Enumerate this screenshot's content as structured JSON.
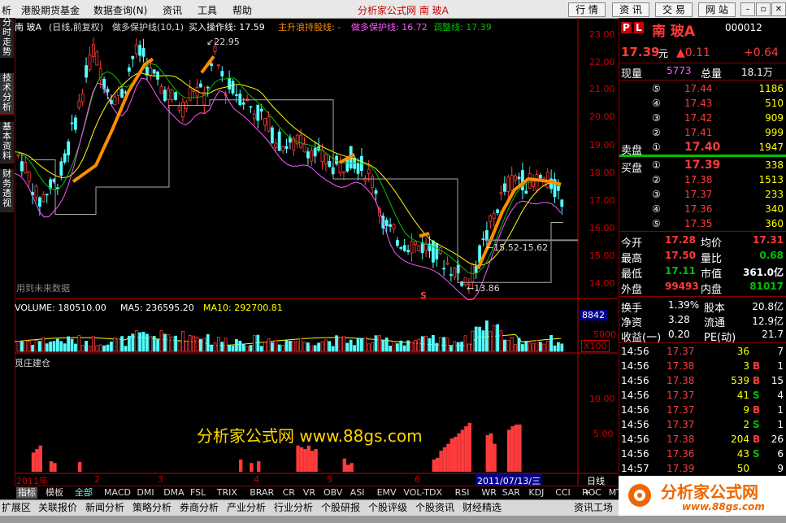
{
  "menu": {
    "items": [
      "析",
      "港股期货基金",
      "数据查询(N)",
      "资讯",
      "工具",
      "帮助"
    ],
    "site_title": "分析家公式网  南  玻A",
    "buttons": [
      "行 情",
      "资 讯",
      "交 易",
      "网 站"
    ]
  },
  "left_tabs": [
    "分时走势",
    "技术分析",
    "基本资料",
    "财务透视"
  ],
  "chart_header": {
    "stock": "南  玻A",
    "mode": "(日线,前复权)",
    "line1": "做多保护线(10,1)",
    "line2": "买入操作线: 17.59",
    "line3": "主升浪持股线: -",
    "line4": "做多保护线: 16.72",
    "line5": "调整线: 17.39"
  },
  "price_axis": [
    "23.00",
    "22.00",
    "21.00",
    "20.00",
    "19.00",
    "18.00",
    "17.00",
    "16.00",
    "15.00",
    "14.00"
  ],
  "annotations": {
    "high": "22.95",
    "low": "13.86",
    "range": "15.52-15.62",
    "future_note": "用到未来数据",
    "marker": "S"
  },
  "volume": {
    "header_vol": "VOLUME: 180510.00",
    "header_ma5": "MA5: 236595.20",
    "header_ma10": "MA10: 292700.81",
    "axis_top": "8842",
    "axis_mid": "5000",
    "axis_unit": "X100"
  },
  "indicator": {
    "name": "觅庄建仓",
    "axis": [
      "10.00",
      "5.00"
    ],
    "watermark": "分析家公式网  www.88gs.com"
  },
  "time_axis": {
    "labels": [
      "2011年",
      "2",
      "3",
      "4",
      "5",
      "6"
    ],
    "cursor_date": "2011/07/13/三",
    "period": "日线"
  },
  "indicator_tabs": [
    "指标",
    "模板",
    "全部",
    "MACD",
    "DMI",
    "DMA",
    "FSL",
    "TRIX",
    "BRAR",
    "CR",
    "VR",
    "OBV",
    "ASI",
    "EMV",
    "VOL-TDX",
    "RSI",
    "WR",
    "SAR",
    "KDJ",
    "CCI",
    "ROC",
    "MTM",
    "BOLL",
    "PSY"
  ],
  "nav_tabs": [
    "扩展区",
    "关联报价",
    "新闻分析",
    "策略分析",
    "券商分析",
    "产业分析",
    "行业分析",
    "个股研报",
    "个股评级",
    "个股资讯",
    "财经精选",
    "资讯工场"
  ],
  "quote": {
    "name": "南  玻A",
    "code": "000012",
    "price": "17.39",
    "unit": "元",
    "change": "▲0.11",
    "change2": "+0.64",
    "cur_vol_label": "现量",
    "cur_vol": "5773",
    "total_vol_label": "总量",
    "total_vol": "18.1万",
    "sell": [
      {
        "lvl": "⑤",
        "price": "17.44",
        "vol": "1186"
      },
      {
        "lvl": "④",
        "price": "17.43",
        "vol": "510"
      },
      {
        "lvl": "③",
        "price": "17.42",
        "vol": "909"
      },
      {
        "lvl": "②",
        "price": "17.41",
        "vol": "999"
      },
      {
        "lvl": "①",
        "price": "17.40",
        "vol": "1947",
        "label": "卖盘"
      }
    ],
    "buy": [
      {
        "lvl": "①",
        "price": "17.39",
        "vol": "338",
        "label": "买盘"
      },
      {
        "lvl": "②",
        "price": "17.38",
        "vol": "1513"
      },
      {
        "lvl": "③",
        "price": "17.37",
        "vol": "233"
      },
      {
        "lvl": "④",
        "price": "17.36",
        "vol": "340"
      },
      {
        "lvl": "⑤",
        "price": "17.35",
        "vol": "360"
      }
    ],
    "stats": [
      {
        "l1": "今开",
        "v1": "17.28",
        "l2": "均价",
        "v2": "17.31"
      },
      {
        "l1": "最高",
        "v1": "17.50",
        "l2": "量比",
        "v2": "0.68"
      },
      {
        "l1": "最低",
        "v1": "17.11",
        "l2": "市值",
        "v2": "361.0亿"
      },
      {
        "l1": "外盘",
        "v1": "99493",
        "l2": "内盘",
        "v2": "81017"
      }
    ],
    "fund": [
      {
        "l1": "换手",
        "v1": "1.39%",
        "l2": "股本",
        "v2": "20.8亿"
      },
      {
        "l1": "净资",
        "v1": "3.28",
        "l2": "流通",
        "v2": "12.9亿"
      },
      {
        "l1": "收益(一)",
        "v1": "0.20",
        "l2": "PE(动)",
        "v2": "21.7"
      }
    ],
    "ticks": [
      {
        "t": "14:56",
        "p": "17.37",
        "v": "36",
        "s": "",
        "n": "7"
      },
      {
        "t": "14:56",
        "p": "17.38",
        "v": "3",
        "s": "B",
        "n": "1"
      },
      {
        "t": "14:56",
        "p": "17.38",
        "v": "539",
        "s": "B",
        "n": "15"
      },
      {
        "t": "14:56",
        "p": "17.37",
        "v": "41",
        "s": "S",
        "n": "4"
      },
      {
        "t": "14:56",
        "p": "17.37",
        "v": "9",
        "s": "B",
        "n": "1"
      },
      {
        "t": "14:56",
        "p": "17.37",
        "v": "2",
        "s": "S",
        "n": "1"
      },
      {
        "t": "14:56",
        "p": "17.38",
        "v": "204",
        "s": "B",
        "n": "26"
      },
      {
        "t": "14:56",
        "p": "17.36",
        "v": "43",
        "s": "S",
        "n": "6"
      },
      {
        "t": "14:57",
        "p": "17.39",
        "v": "50",
        "s": "",
        "n": "9"
      }
    ]
  },
  "logo": {
    "text": "分析家公式网",
    "url": "www.88gs.com"
  },
  "colors": {
    "up": "#ff3b3b",
    "down": "#54ffff",
    "orange": "#ff8c00",
    "yellow": "#ffff00",
    "green": "#00c000",
    "magenta": "#ff55ff",
    "axis": "#c00000"
  },
  "chart_data": {
    "type": "candlestick",
    "price_range": [
      13.5,
      23.5
    ],
    "indicator_values": [
      0,
      0,
      5.5,
      6.5,
      7.5,
      0,
      0,
      3,
      2.5,
      0,
      0,
      0,
      0,
      0,
      0,
      2.8,
      0,
      0,
      0,
      0,
      0,
      0,
      0,
      0,
      0,
      0,
      0,
      0,
      0,
      0,
      0,
      0,
      0,
      0,
      0,
      0,
      0,
      0,
      0,
      0,
      0,
      0,
      0,
      0,
      0,
      0,
      0,
      0,
      0,
      0,
      0,
      0,
      0,
      0,
      0,
      0,
      0,
      0,
      0,
      0,
      3.5,
      0,
      0,
      2.5,
      0,
      3,
      0,
      0,
      0,
      0,
      0,
      0,
      0,
      0,
      0,
      0,
      7.5,
      7,
      6.5,
      7.5,
      6,
      6.5,
      0,
      0,
      0,
      0,
      0,
      0,
      0,
      3.8,
      2,
      2.5,
      0,
      0,
      0,
      0,
      0,
      0,
      0,
      0,
      0,
      0,
      0,
      0,
      0,
      0,
      0,
      0,
      0,
      0,
      0,
      0,
      0,
      0,
      3.5,
      4,
      6,
      7,
      8,
      9.5,
      10,
      11,
      12,
      13,
      14,
      0,
      0,
      0,
      0,
      10.5,
      11,
      8,
      0,
      0,
      0,
      12,
      13,
      13.5,
      13.5,
      0,
      0,
      0,
      0,
      0,
      0,
      0,
      0,
      0,
      0,
      0,
      0,
      0,
      0,
      0
    ]
  }
}
